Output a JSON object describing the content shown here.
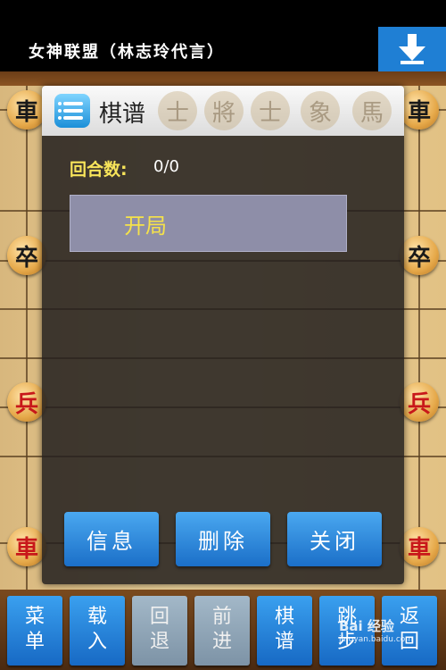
{
  "banner": {
    "text": "女神联盟（林志玲代言）"
  },
  "pieces": {
    "left": [
      "車",
      "卒",
      "兵",
      "車"
    ],
    "right": [
      "車",
      "卒",
      "兵",
      "車"
    ]
  },
  "dialog": {
    "title": "棋谱",
    "rounds_label": "回合数:",
    "rounds_value": "0/0",
    "moves": [
      "开局"
    ],
    "buttons": {
      "info": "信息",
      "delete": "删除",
      "close": "关闭"
    }
  },
  "header_ghost_pieces": [
    "士",
    "將",
    "士",
    "象",
    "馬"
  ],
  "toolbar": {
    "buttons": [
      {
        "line1": "菜",
        "line2": "单",
        "enabled": true
      },
      {
        "line1": "载",
        "line2": "入",
        "enabled": true
      },
      {
        "line1": "回",
        "line2": "退",
        "enabled": false
      },
      {
        "line1": "前",
        "line2": "进",
        "enabled": false
      },
      {
        "line1": "棋",
        "line2": "谱",
        "enabled": true
      },
      {
        "line1": "跳",
        "line2": "步",
        "enabled": true
      },
      {
        "line1": "返",
        "line2": "回",
        "enabled": true
      }
    ]
  },
  "watermark": {
    "brand": "Bai 经验",
    "url": "jingyan.baidu.com"
  },
  "colors": {
    "button_blue": "#1f7fd4",
    "highlight_yellow": "#f5e24a",
    "red_piece": "#c8181a"
  }
}
